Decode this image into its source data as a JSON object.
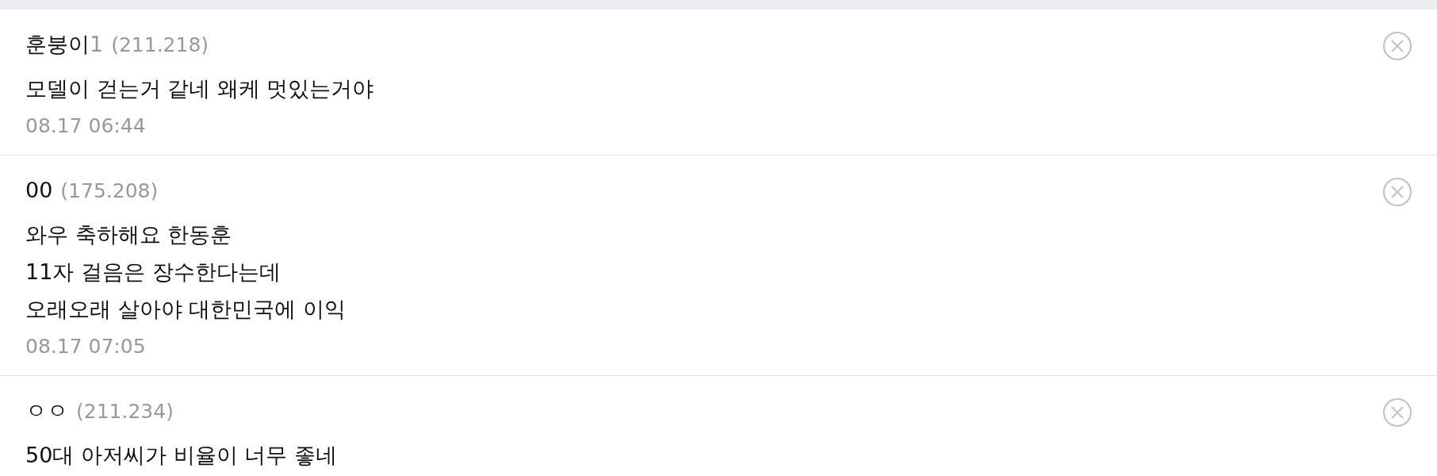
{
  "comments": [
    {
      "name": "훈붕이",
      "name_suffix": "1",
      "ip": "(211.218)",
      "lines": [
        "모델이 걷는거 같네 왜케 멋있는거야"
      ],
      "time": "08.17 06:44"
    },
    {
      "name": "00",
      "ip": "(175.208)",
      "lines": [
        "와우 축하해요 한동훈",
        "11자 걸음은 장수한다는데",
        "오래오래 살아야 대한민국에 이익"
      ],
      "time": "08.17 07:05"
    },
    {
      "name": "ㅇㅇ",
      "ip": "(211.234)",
      "lines": [
        "50대 아저씨가 비율이 너무 좋네"
      ]
    }
  ]
}
